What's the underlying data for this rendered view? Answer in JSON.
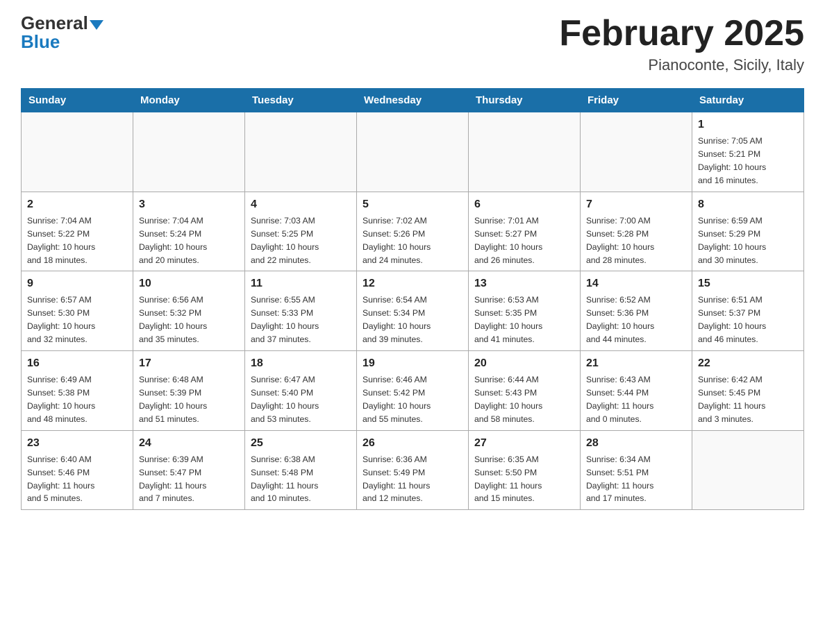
{
  "header": {
    "logo_general": "General",
    "logo_blue": "Blue",
    "month_title": "February 2025",
    "location": "Pianoconte, Sicily, Italy"
  },
  "days_of_week": [
    "Sunday",
    "Monday",
    "Tuesday",
    "Wednesday",
    "Thursday",
    "Friday",
    "Saturday"
  ],
  "weeks": [
    [
      {
        "day": "",
        "info": ""
      },
      {
        "day": "",
        "info": ""
      },
      {
        "day": "",
        "info": ""
      },
      {
        "day": "",
        "info": ""
      },
      {
        "day": "",
        "info": ""
      },
      {
        "day": "",
        "info": ""
      },
      {
        "day": "1",
        "info": "Sunrise: 7:05 AM\nSunset: 5:21 PM\nDaylight: 10 hours\nand 16 minutes."
      }
    ],
    [
      {
        "day": "2",
        "info": "Sunrise: 7:04 AM\nSunset: 5:22 PM\nDaylight: 10 hours\nand 18 minutes."
      },
      {
        "day": "3",
        "info": "Sunrise: 7:04 AM\nSunset: 5:24 PM\nDaylight: 10 hours\nand 20 minutes."
      },
      {
        "day": "4",
        "info": "Sunrise: 7:03 AM\nSunset: 5:25 PM\nDaylight: 10 hours\nand 22 minutes."
      },
      {
        "day": "5",
        "info": "Sunrise: 7:02 AM\nSunset: 5:26 PM\nDaylight: 10 hours\nand 24 minutes."
      },
      {
        "day": "6",
        "info": "Sunrise: 7:01 AM\nSunset: 5:27 PM\nDaylight: 10 hours\nand 26 minutes."
      },
      {
        "day": "7",
        "info": "Sunrise: 7:00 AM\nSunset: 5:28 PM\nDaylight: 10 hours\nand 28 minutes."
      },
      {
        "day": "8",
        "info": "Sunrise: 6:59 AM\nSunset: 5:29 PM\nDaylight: 10 hours\nand 30 minutes."
      }
    ],
    [
      {
        "day": "9",
        "info": "Sunrise: 6:57 AM\nSunset: 5:30 PM\nDaylight: 10 hours\nand 32 minutes."
      },
      {
        "day": "10",
        "info": "Sunrise: 6:56 AM\nSunset: 5:32 PM\nDaylight: 10 hours\nand 35 minutes."
      },
      {
        "day": "11",
        "info": "Sunrise: 6:55 AM\nSunset: 5:33 PM\nDaylight: 10 hours\nand 37 minutes."
      },
      {
        "day": "12",
        "info": "Sunrise: 6:54 AM\nSunset: 5:34 PM\nDaylight: 10 hours\nand 39 minutes."
      },
      {
        "day": "13",
        "info": "Sunrise: 6:53 AM\nSunset: 5:35 PM\nDaylight: 10 hours\nand 41 minutes."
      },
      {
        "day": "14",
        "info": "Sunrise: 6:52 AM\nSunset: 5:36 PM\nDaylight: 10 hours\nand 44 minutes."
      },
      {
        "day": "15",
        "info": "Sunrise: 6:51 AM\nSunset: 5:37 PM\nDaylight: 10 hours\nand 46 minutes."
      }
    ],
    [
      {
        "day": "16",
        "info": "Sunrise: 6:49 AM\nSunset: 5:38 PM\nDaylight: 10 hours\nand 48 minutes."
      },
      {
        "day": "17",
        "info": "Sunrise: 6:48 AM\nSunset: 5:39 PM\nDaylight: 10 hours\nand 51 minutes."
      },
      {
        "day": "18",
        "info": "Sunrise: 6:47 AM\nSunset: 5:40 PM\nDaylight: 10 hours\nand 53 minutes."
      },
      {
        "day": "19",
        "info": "Sunrise: 6:46 AM\nSunset: 5:42 PM\nDaylight: 10 hours\nand 55 minutes."
      },
      {
        "day": "20",
        "info": "Sunrise: 6:44 AM\nSunset: 5:43 PM\nDaylight: 10 hours\nand 58 minutes."
      },
      {
        "day": "21",
        "info": "Sunrise: 6:43 AM\nSunset: 5:44 PM\nDaylight: 11 hours\nand 0 minutes."
      },
      {
        "day": "22",
        "info": "Sunrise: 6:42 AM\nSunset: 5:45 PM\nDaylight: 11 hours\nand 3 minutes."
      }
    ],
    [
      {
        "day": "23",
        "info": "Sunrise: 6:40 AM\nSunset: 5:46 PM\nDaylight: 11 hours\nand 5 minutes."
      },
      {
        "day": "24",
        "info": "Sunrise: 6:39 AM\nSunset: 5:47 PM\nDaylight: 11 hours\nand 7 minutes."
      },
      {
        "day": "25",
        "info": "Sunrise: 6:38 AM\nSunset: 5:48 PM\nDaylight: 11 hours\nand 10 minutes."
      },
      {
        "day": "26",
        "info": "Sunrise: 6:36 AM\nSunset: 5:49 PM\nDaylight: 11 hours\nand 12 minutes."
      },
      {
        "day": "27",
        "info": "Sunrise: 6:35 AM\nSunset: 5:50 PM\nDaylight: 11 hours\nand 15 minutes."
      },
      {
        "day": "28",
        "info": "Sunrise: 6:34 AM\nSunset: 5:51 PM\nDaylight: 11 hours\nand 17 minutes."
      },
      {
        "day": "",
        "info": ""
      }
    ]
  ]
}
